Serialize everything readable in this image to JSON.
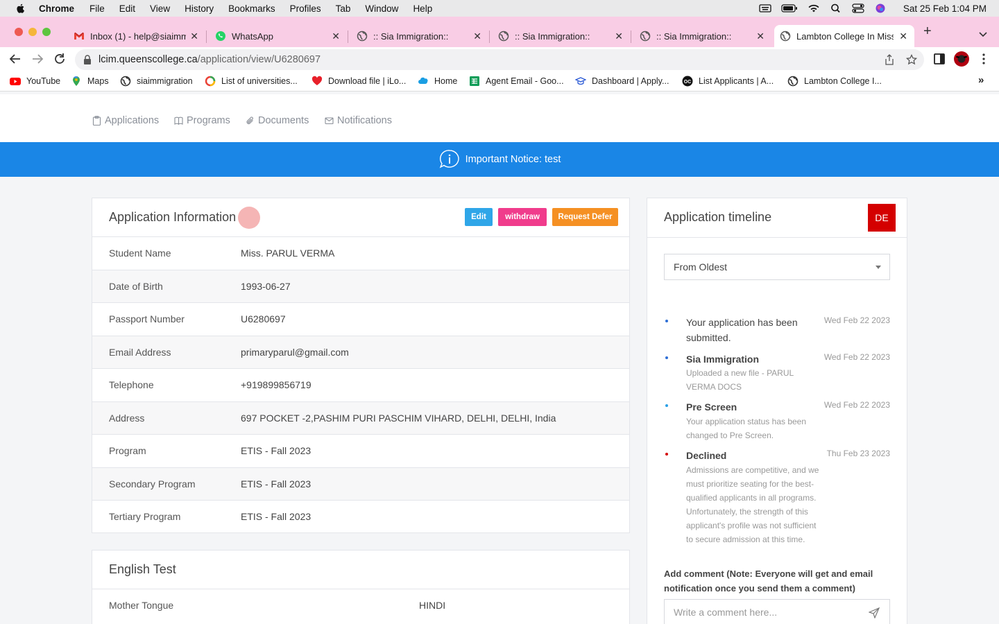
{
  "menubar": {
    "items": [
      "Chrome",
      "File",
      "Edit",
      "View",
      "History",
      "Bookmarks",
      "Profiles",
      "Tab",
      "Window",
      "Help"
    ],
    "datetime": "Sat 25 Feb  1:04 PM"
  },
  "tabs": [
    {
      "title": "Inbox (1) - help@siaimmi",
      "icon": "gmail-icon"
    },
    {
      "title": "WhatsApp",
      "icon": "whatsapp-icon"
    },
    {
      "title": ":: Sia Immigration::",
      "icon": "globe-icon"
    },
    {
      "title": ":: Sia Immigration::",
      "icon": "globe-icon"
    },
    {
      "title": ":: Sia Immigration::",
      "icon": "globe-icon"
    },
    {
      "title": "Lambton College In Miss",
      "icon": "globe-icon"
    }
  ],
  "address": {
    "host": "lcim.queenscollege.ca",
    "path": "/application/view/U6280697"
  },
  "bookmarks": [
    {
      "label": "YouTube",
      "icon": "youtube-icon"
    },
    {
      "label": "Maps",
      "icon": "maps-icon"
    },
    {
      "label": "siaimmigration",
      "icon": "globe-icon"
    },
    {
      "label": "List of universities...",
      "icon": "list-icon"
    },
    {
      "label": "Download file | iLo...",
      "icon": "heart-icon"
    },
    {
      "label": "Home",
      "icon": "salesforce-icon"
    },
    {
      "label": "Agent Email - Goo...",
      "icon": "sheets-icon"
    },
    {
      "label": "Dashboard | Apply...",
      "icon": "graduation-icon"
    },
    {
      "label": "List Applicants | A...",
      "icon": "oc-icon"
    },
    {
      "label": "Lambton College I...",
      "icon": "globe-icon"
    }
  ],
  "nav": {
    "applications": "Applications",
    "programs": "Programs",
    "documents": "Documents",
    "notifications": "Notifications"
  },
  "notice": "Important Notice: test",
  "app_info": {
    "title": "Application Information",
    "buttons": {
      "edit": "Edit",
      "withdraw": "withdraw",
      "defer": "Request Defer"
    },
    "rows": [
      {
        "label": "Student Name",
        "value": "Miss. PARUL VERMA"
      },
      {
        "label": "Date of Birth",
        "value": "1993-06-27"
      },
      {
        "label": "Passport Number",
        "value": "U6280697"
      },
      {
        "label": "Email Address",
        "value": "primaryparul@gmail.com"
      },
      {
        "label": "Telephone",
        "value": "+919899856719"
      },
      {
        "label": "Address",
        "value": "697 POCKET -2,PASHIM PURI PASCHIM VIHARD, DELHI, DELHI, India"
      },
      {
        "label": "Program",
        "value": "ETIS - Fall 2023"
      },
      {
        "label": "Secondary Program",
        "value": "ETIS - Fall 2023"
      },
      {
        "label": "Tertiary Program",
        "value": "ETIS - Fall 2023"
      }
    ]
  },
  "english": {
    "title": "English Test",
    "rows": [
      {
        "label": "Mother Tongue",
        "value": "HINDI"
      }
    ]
  },
  "timeline": {
    "title": "Application timeline",
    "badge": "DE",
    "sort": "From Oldest",
    "events": [
      {
        "title": "Your application has been submitted.",
        "date": "Wed Feb 22 2023",
        "desc": "",
        "color": "#2f6fd6"
      },
      {
        "title": "Sia Immigration",
        "date": "Wed Feb 22 2023",
        "desc": "Uploaded a new file - PARUL VERMA DOCS",
        "color": "#2f6fd6"
      },
      {
        "title": "Pre Screen",
        "date": "Wed Feb 22 2023",
        "desc": "Your application status has been changed to Pre Screen.",
        "color": "#2aa0e6"
      },
      {
        "title": "Declined",
        "date": "Thu Feb 23 2023",
        "desc": "Admissions are competitive, and we must prioritize seating for the best-qualified applicants in all programs. Unfortunately, the strength of this applicant's profile was not sufficient to secure admission at this time.",
        "color": "#d40000"
      }
    ],
    "comment_label": "Add comment (Note: Everyone will get and email notification once you send them a comment)",
    "comment_placeholder": "Write a comment here..."
  }
}
